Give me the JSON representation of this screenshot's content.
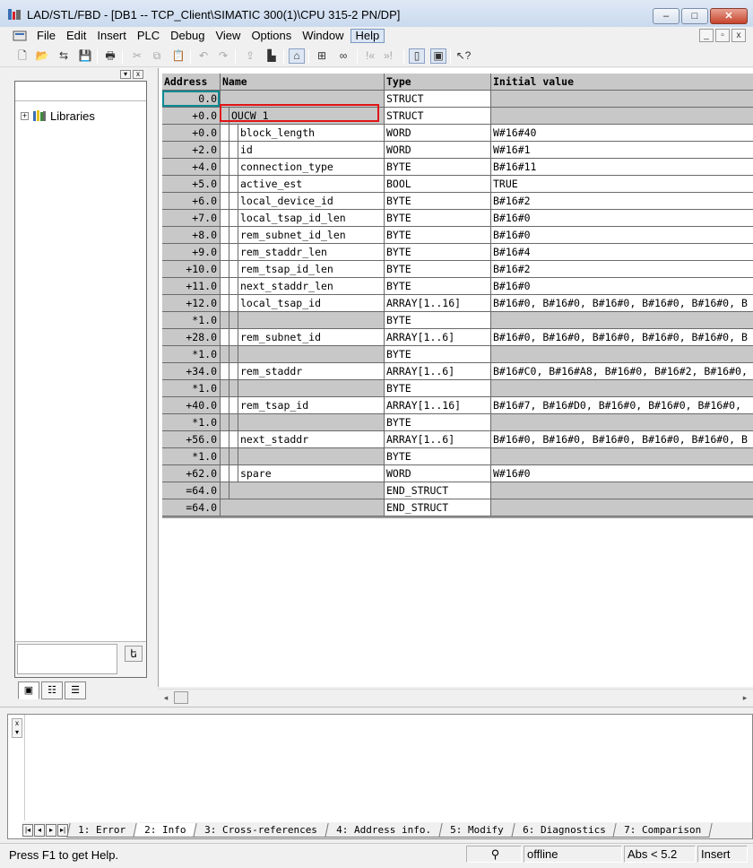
{
  "window": {
    "title": "LAD/STL/FBD  - [DB1 -- TCP_Client\\SIMATIC 300(1)\\CPU 315-2 PN/DP]",
    "controls": {
      "minimize": "–",
      "maximize": "□",
      "close": "✕"
    }
  },
  "menu": {
    "items": [
      "File",
      "Edit",
      "Insert",
      "PLC",
      "Debug",
      "View",
      "Options",
      "Window",
      "Help"
    ],
    "active": "Help",
    "mdi": [
      "_",
      "▫",
      "x"
    ]
  },
  "toolbar": {
    "icons": [
      "new-icon",
      "open-icon",
      "network-icon",
      "save-icon",
      "print-icon",
      "cut-icon",
      "copy-icon",
      "paste-icon",
      "undo-icon",
      "redo-icon",
      "load-icon",
      "monitor-icon",
      "compare-icon",
      "network-config-icon",
      "glasses-icon",
      "bookmark-back-icon",
      "bookmark-forward-icon",
      "overview-icon",
      "details-icon",
      "help-icon"
    ]
  },
  "left_panel": {
    "tree": [
      {
        "label": "Libraries",
        "expander": "+"
      }
    ],
    "tabs": [
      "▣",
      "☷",
      "☰"
    ],
    "pin": "ե"
  },
  "table": {
    "headers": {
      "address": "Address",
      "name": "Name",
      "type": "Type",
      "initial": "Initial value"
    },
    "rows": [
      {
        "address": "0.0",
        "name": "",
        "level": 0,
        "type": "STRUCT",
        "initial": "",
        "gray": true
      },
      {
        "address": "+0.0",
        "name": "OUCW_1",
        "level": 1,
        "type": "STRUCT",
        "initial": "",
        "gray": true
      },
      {
        "address": "+0.0",
        "name": "block_length",
        "level": 2,
        "type": "WORD",
        "initial": "W#16#40"
      },
      {
        "address": "+2.0",
        "name": "id",
        "level": 2,
        "type": "WORD",
        "initial": "W#16#1"
      },
      {
        "address": "+4.0",
        "name": "connection_type",
        "level": 2,
        "type": "BYTE",
        "initial": "B#16#11"
      },
      {
        "address": "+5.0",
        "name": "active_est",
        "level": 2,
        "type": "BOOL",
        "initial": "TRUE"
      },
      {
        "address": "+6.0",
        "name": "local_device_id",
        "level": 2,
        "type": "BYTE",
        "initial": "B#16#2"
      },
      {
        "address": "+7.0",
        "name": "local_tsap_id_len",
        "level": 2,
        "type": "BYTE",
        "initial": "B#16#0"
      },
      {
        "address": "+8.0",
        "name": "rem_subnet_id_len",
        "level": 2,
        "type": "BYTE",
        "initial": "B#16#0"
      },
      {
        "address": "+9.0",
        "name": "rem_staddr_len",
        "level": 2,
        "type": "BYTE",
        "initial": "B#16#4"
      },
      {
        "address": "+10.0",
        "name": "rem_tsap_id_len",
        "level": 2,
        "type": "BYTE",
        "initial": "B#16#2"
      },
      {
        "address": "+11.0",
        "name": "next_staddr_len",
        "level": 2,
        "type": "BYTE",
        "initial": "B#16#0"
      },
      {
        "address": "+12.0",
        "name": "local_tsap_id",
        "level": 2,
        "type": "ARRAY[1..16]",
        "initial": "B#16#0, B#16#0, B#16#0, B#16#0, B#16#0, B",
        "gray_type": true
      },
      {
        "address": "*1.0",
        "name": "",
        "level": 2,
        "type": "BYTE",
        "initial": "",
        "gray": true
      },
      {
        "address": "+28.0",
        "name": "rem_subnet_id",
        "level": 2,
        "type": "ARRAY[1..6]",
        "initial": "B#16#0, B#16#0, B#16#0, B#16#0, B#16#0, B",
        "gray_type": true
      },
      {
        "address": "*1.0",
        "name": "",
        "level": 2,
        "type": "BYTE",
        "initial": "",
        "gray": true
      },
      {
        "address": "+34.0",
        "name": "rem_staddr",
        "level": 2,
        "type": "ARRAY[1..6]",
        "initial": "B#16#C0, B#16#A8, B#16#0, B#16#2, B#16#0,",
        "gray_type": true
      },
      {
        "address": "*1.0",
        "name": "",
        "level": 2,
        "type": "BYTE",
        "initial": "",
        "gray": true
      },
      {
        "address": "+40.0",
        "name": "rem_tsap_id",
        "level": 2,
        "type": "ARRAY[1..16]",
        "initial": "B#16#7, B#16#D0, B#16#0, B#16#0, B#16#0,",
        "gray_type": true
      },
      {
        "address": "*1.0",
        "name": "",
        "level": 2,
        "type": "BYTE",
        "initial": "",
        "gray": true
      },
      {
        "address": "+56.0",
        "name": "next_staddr",
        "level": 2,
        "type": "ARRAY[1..6]",
        "initial": "B#16#0, B#16#0, B#16#0, B#16#0, B#16#0, B",
        "gray_type": true
      },
      {
        "address": "*1.0",
        "name": "",
        "level": 2,
        "type": "BYTE",
        "initial": "",
        "gray": true
      },
      {
        "address": "+62.0",
        "name": "spare",
        "level": 2,
        "type": "WORD",
        "initial": "W#16#0"
      },
      {
        "address": "=64.0",
        "name": "",
        "level": 1,
        "type": "END_STRUCT",
        "initial": "",
        "gray": true
      },
      {
        "address": "=64.0",
        "name": "",
        "level": 0,
        "type": "END_STRUCT",
        "initial": "",
        "gray": true
      }
    ],
    "highlighted_row": 1,
    "selected_address_row": 0
  },
  "scrollbar": {
    "left_arrow": "◂",
    "right_arrow": "▸"
  },
  "output_tabs": [
    "1: Error",
    "2: Info",
    "3: Cross-references",
    "4: Address info.",
    "5: Modify",
    "6: Diagnostics",
    "7: Comparison"
  ],
  "output_active_tab": "2: Info",
  "status": {
    "help": "Press F1 to get Help.",
    "mode": "offline",
    "position": "Abs < 5.2",
    "insert": "Insert"
  },
  "colors": {
    "highlight_border": "#e01515",
    "selection_border": "#0a8a93",
    "grid_gray": "#c8c8c8"
  }
}
